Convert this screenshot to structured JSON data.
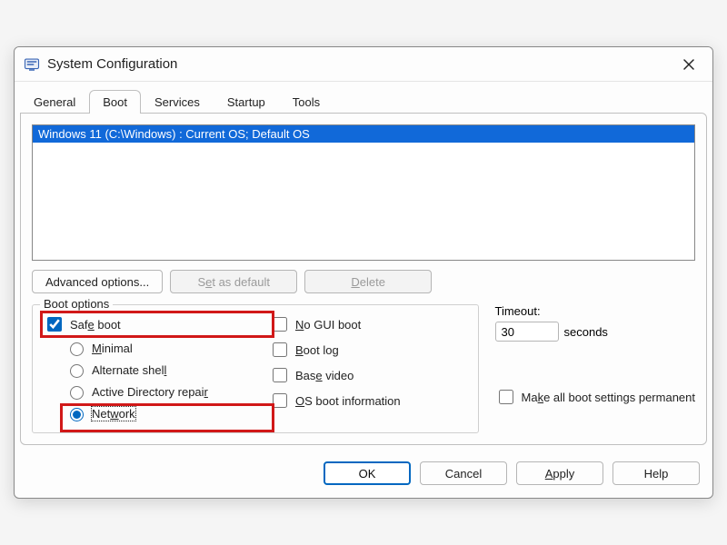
{
  "window": {
    "title": "System Configuration"
  },
  "tabs": [
    {
      "label": "General"
    },
    {
      "label": "Boot"
    },
    {
      "label": "Services"
    },
    {
      "label": "Startup"
    },
    {
      "label": "Tools"
    }
  ],
  "active_tab_index": 1,
  "os_list": {
    "items": [
      "Windows 11 (C:\\Windows) : Current OS; Default OS"
    ],
    "selected_index": 0
  },
  "buttons": {
    "advanced": {
      "text": "Advanced options...",
      "enabled": true
    },
    "set_default": {
      "pre": "S",
      "ul": "e",
      "post": "t as default",
      "enabled": false
    },
    "delete": {
      "pre": "",
      "ul": "D",
      "post": "elete",
      "enabled": false
    }
  },
  "boot_options": {
    "legend": "Boot options",
    "safe_boot": {
      "label_pre": "Saf",
      "label_ul": "e",
      "label_post": " boot",
      "checked": true
    },
    "modes": [
      {
        "id": "minimal",
        "label_pre": "",
        "label_ul": "M",
        "label_post": "inimal",
        "selected": false
      },
      {
        "id": "altshell",
        "label_pre": "Alternate shel",
        "label_ul": "l",
        "label_post": "",
        "selected": false
      },
      {
        "id": "adrepair",
        "label_pre": "Active Directory repai",
        "label_ul": "r",
        "label_post": "",
        "selected": false
      },
      {
        "id": "network",
        "label_pre": "Net",
        "label_ul": "w",
        "label_post": "ork",
        "selected": true
      }
    ],
    "right": {
      "no_gui": {
        "label_pre": "",
        "label_ul": "N",
        "label_post": "o GUI boot",
        "checked": false
      },
      "boot_log": {
        "label_pre": "",
        "label_ul": "B",
        "label_post": "oot log",
        "checked": false
      },
      "base_video": {
        "label_pre": "Bas",
        "label_ul": "e",
        "label_post": " video",
        "checked": false
      },
      "os_info": {
        "label_pre": "",
        "label_ul": "O",
        "label_post": "S boot information",
        "checked": false
      }
    }
  },
  "timeout": {
    "label": "Timeout:",
    "value": "30",
    "unit": "seconds"
  },
  "make_permanent": {
    "label_pre": "Ma",
    "label_ul": "k",
    "label_post": "e all boot settings permanent",
    "checked": false
  },
  "footer": {
    "ok": "OK",
    "cancel": "Cancel",
    "apply": {
      "pre": "",
      "ul": "A",
      "post": "pply"
    },
    "help": "Help"
  }
}
